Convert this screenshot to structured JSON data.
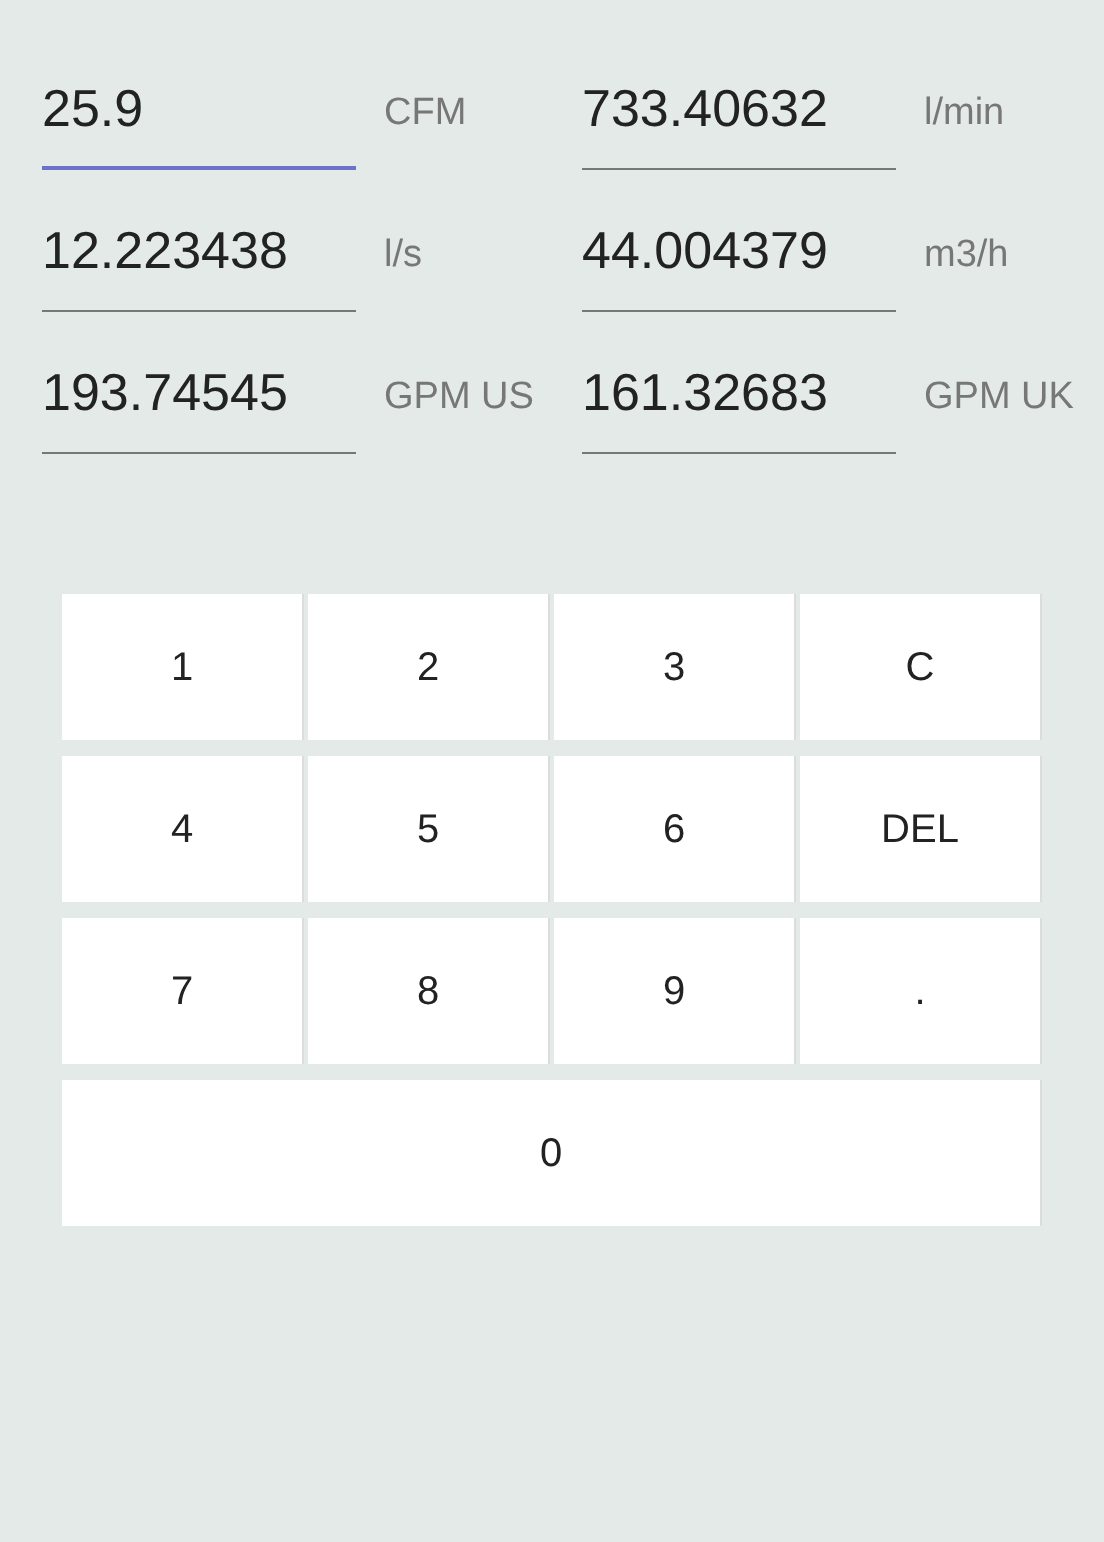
{
  "fields": [
    {
      "value": "25.9",
      "unit": "CFM",
      "focused": true
    },
    {
      "value": "733.40632",
      "unit": "l/min",
      "focused": false
    },
    {
      "value": "12.223438",
      "unit": "l/s",
      "focused": false
    },
    {
      "value": "44.004379",
      "unit": "m3/h",
      "focused": false
    },
    {
      "value": "193.74545",
      "unit": "GPM US",
      "focused": false
    },
    {
      "value": "161.32683",
      "unit": "GPM UK",
      "focused": false
    }
  ],
  "keypad": [
    [
      "1",
      "2",
      "3",
      "C"
    ],
    [
      "4",
      "5",
      "6",
      "DEL"
    ],
    [
      "7",
      "8",
      "9",
      "."
    ],
    [
      "0"
    ]
  ]
}
